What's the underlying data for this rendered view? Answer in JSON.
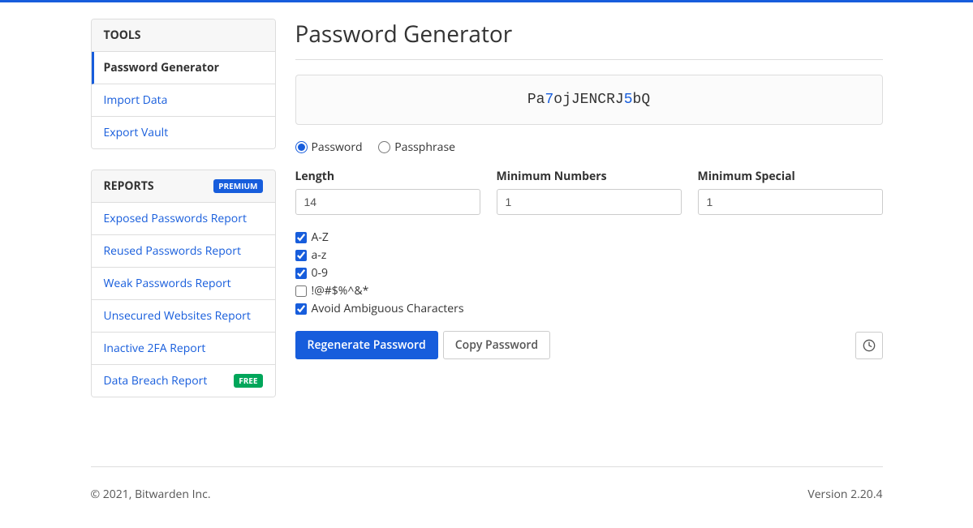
{
  "sidebar": {
    "tools": {
      "header": "Tools",
      "items": [
        {
          "label": "Password Generator"
        },
        {
          "label": "Import Data"
        },
        {
          "label": "Export Vault"
        }
      ]
    },
    "reports": {
      "header": "Reports",
      "badge": "Premium",
      "items": [
        {
          "label": "Exposed Passwords Report"
        },
        {
          "label": "Reused Passwords Report"
        },
        {
          "label": "Weak Passwords Report"
        },
        {
          "label": "Unsecured Websites Report"
        },
        {
          "label": "Inactive 2FA Report"
        },
        {
          "label": "Data Breach Report",
          "badge": "Free"
        }
      ]
    }
  },
  "main": {
    "title": "Password Generator",
    "password_segments": [
      {
        "t": "Pa",
        "c": "l"
      },
      {
        "t": "7",
        "c": "n"
      },
      {
        "t": "ojJENCRJ",
        "c": "l"
      },
      {
        "t": "5",
        "c": "n"
      },
      {
        "t": "bQ",
        "c": "l"
      }
    ],
    "type_options": {
      "password": "Password",
      "passphrase": "Passphrase"
    },
    "fields": {
      "length": {
        "label": "Length",
        "value": "14"
      },
      "min_numbers": {
        "label": "Minimum Numbers",
        "value": "1"
      },
      "min_special": {
        "label": "Minimum Special",
        "value": "1"
      }
    },
    "checks": {
      "upper": {
        "label": "A-Z",
        "checked": true
      },
      "lower": {
        "label": "a-z",
        "checked": true
      },
      "numbers": {
        "label": "0-9",
        "checked": true
      },
      "special": {
        "label": "!@#$%^&*",
        "checked": false
      },
      "ambiguous": {
        "label": "Avoid Ambiguous Characters",
        "checked": true
      }
    },
    "buttons": {
      "regen": "Regenerate Password",
      "copy": "Copy Password"
    }
  },
  "footer": {
    "copyright": "© 2021, Bitwarden Inc.",
    "version": "Version 2.20.4"
  }
}
